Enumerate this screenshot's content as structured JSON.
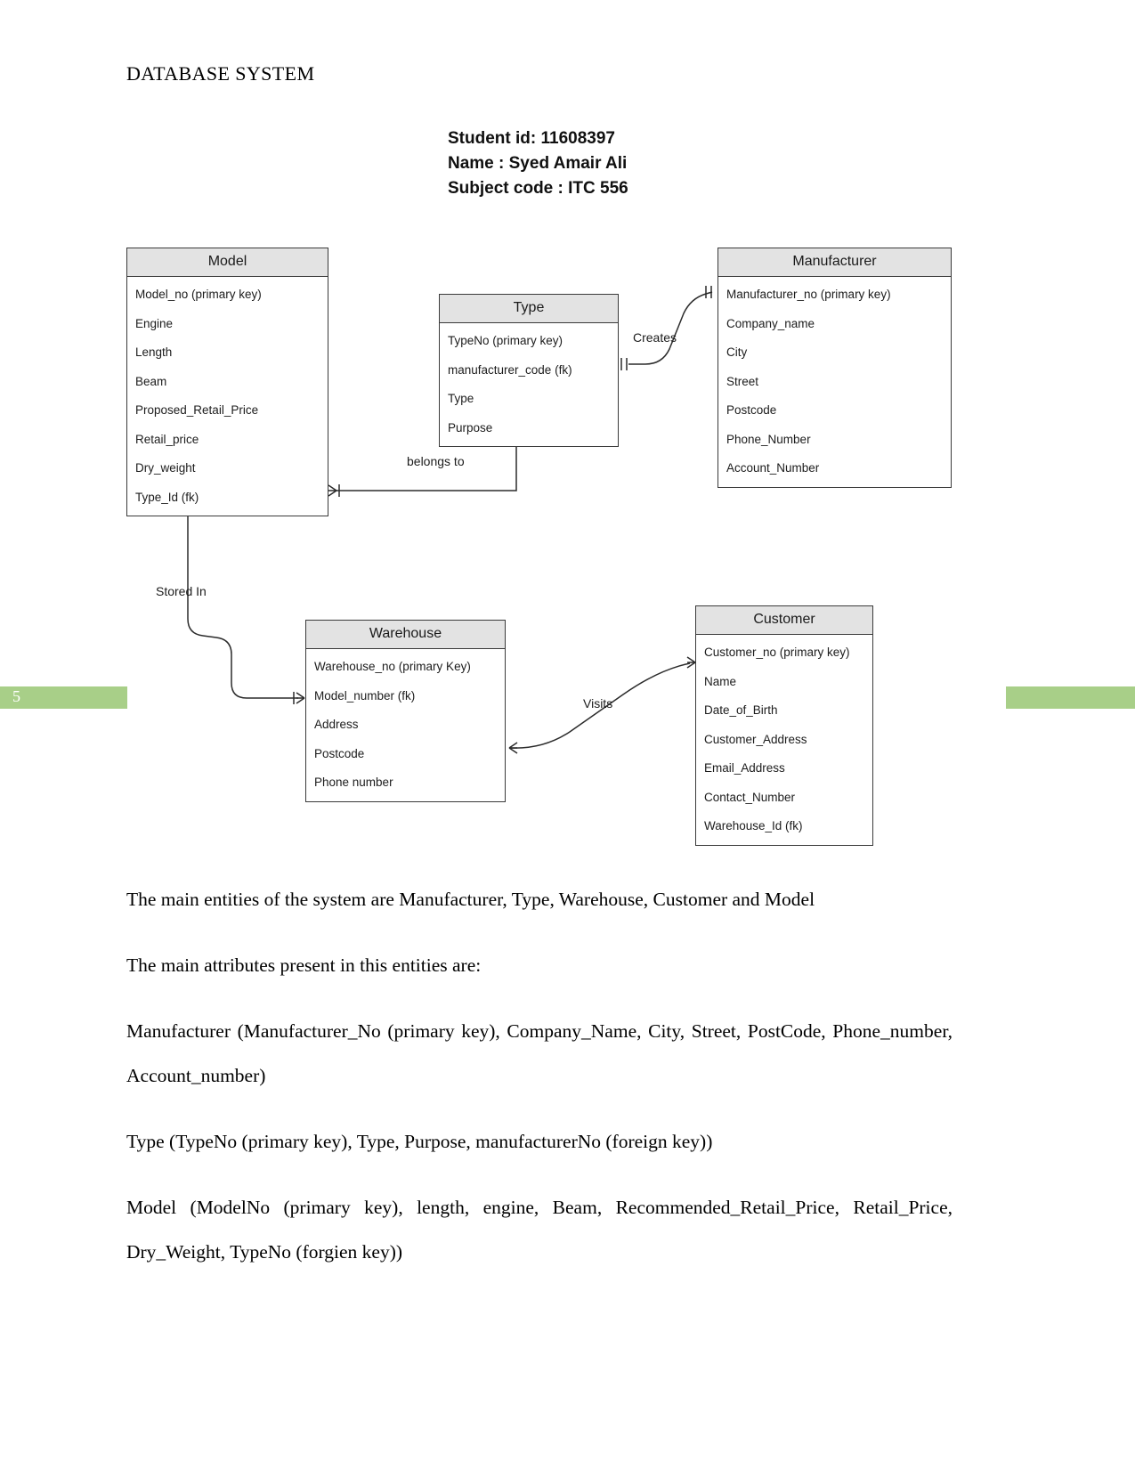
{
  "document": {
    "header": "DATABASE SYSTEM",
    "page_number": "5",
    "accent_color": "#a8cf88"
  },
  "student_info": {
    "student_id_line": "Student id: 11608397",
    "name_line": "Name : Syed Amair Ali",
    "subject_line": "Subject code : ITC 556"
  },
  "diagram": {
    "type": "entity-relationship-diagram",
    "entities": [
      {
        "id": "model",
        "title": "Model",
        "attributes": [
          "Model_no (primary key)",
          "Engine",
          "Length",
          "Beam",
          "Proposed_Retail_Price",
          "Retail_price",
          "Dry_weight",
          "Type_Id (fk)"
        ]
      },
      {
        "id": "type",
        "title": "Type",
        "attributes": [
          "TypeNo (primary key)",
          "manufacturer_code (fk)",
          "Type",
          "Purpose"
        ]
      },
      {
        "id": "manufacturer",
        "title": "Manufacturer",
        "attributes": [
          "Manufacturer_no (primary key)",
          "Company_name",
          "City",
          "Street",
          "Postcode",
          "Phone_Number",
          "Account_Number"
        ]
      },
      {
        "id": "warehouse",
        "title": "Warehouse",
        "attributes": [
          "Warehouse_no (primary Key)",
          "Model_number (fk)",
          "Address",
          "Postcode",
          "Phone number"
        ]
      },
      {
        "id": "customer",
        "title": "Customer",
        "attributes": [
          "Customer_no (primary key)",
          "Name",
          "Date_of_Birth",
          "Customer_Address",
          "Email_Address",
          "Contact_Number",
          "Warehouse_Id (fk)"
        ]
      }
    ],
    "relationships": [
      {
        "id": "creates",
        "label": "Creates",
        "from": "type",
        "to": "manufacturer"
      },
      {
        "id": "belongs-to",
        "label": "belongs to",
        "from": "model",
        "to": "type"
      },
      {
        "id": "stored-in",
        "label": "Stored In",
        "from": "model",
        "to": "warehouse"
      },
      {
        "id": "visits",
        "label": "Visits",
        "from": "warehouse",
        "to": "customer"
      }
    ]
  },
  "body": {
    "paragraphs": [
      "The main entities of the system are Manufacturer, Type, Warehouse, Customer and Model",
      "The main attributes present in this entities are:",
      "Manufacturer (Manufacturer_No (primary key), Company_Name, City, Street, PostCode, Phone_number, Account_number)",
      "Type (TypeNo (primary key), Type, Purpose, manufacturerNo (foreign key))",
      "Model (ModelNo (primary key), length, engine, Beam, Recommended_Retail_Price, Retail_Price, Dry_Weight, TypeNo (forgien key))"
    ]
  }
}
